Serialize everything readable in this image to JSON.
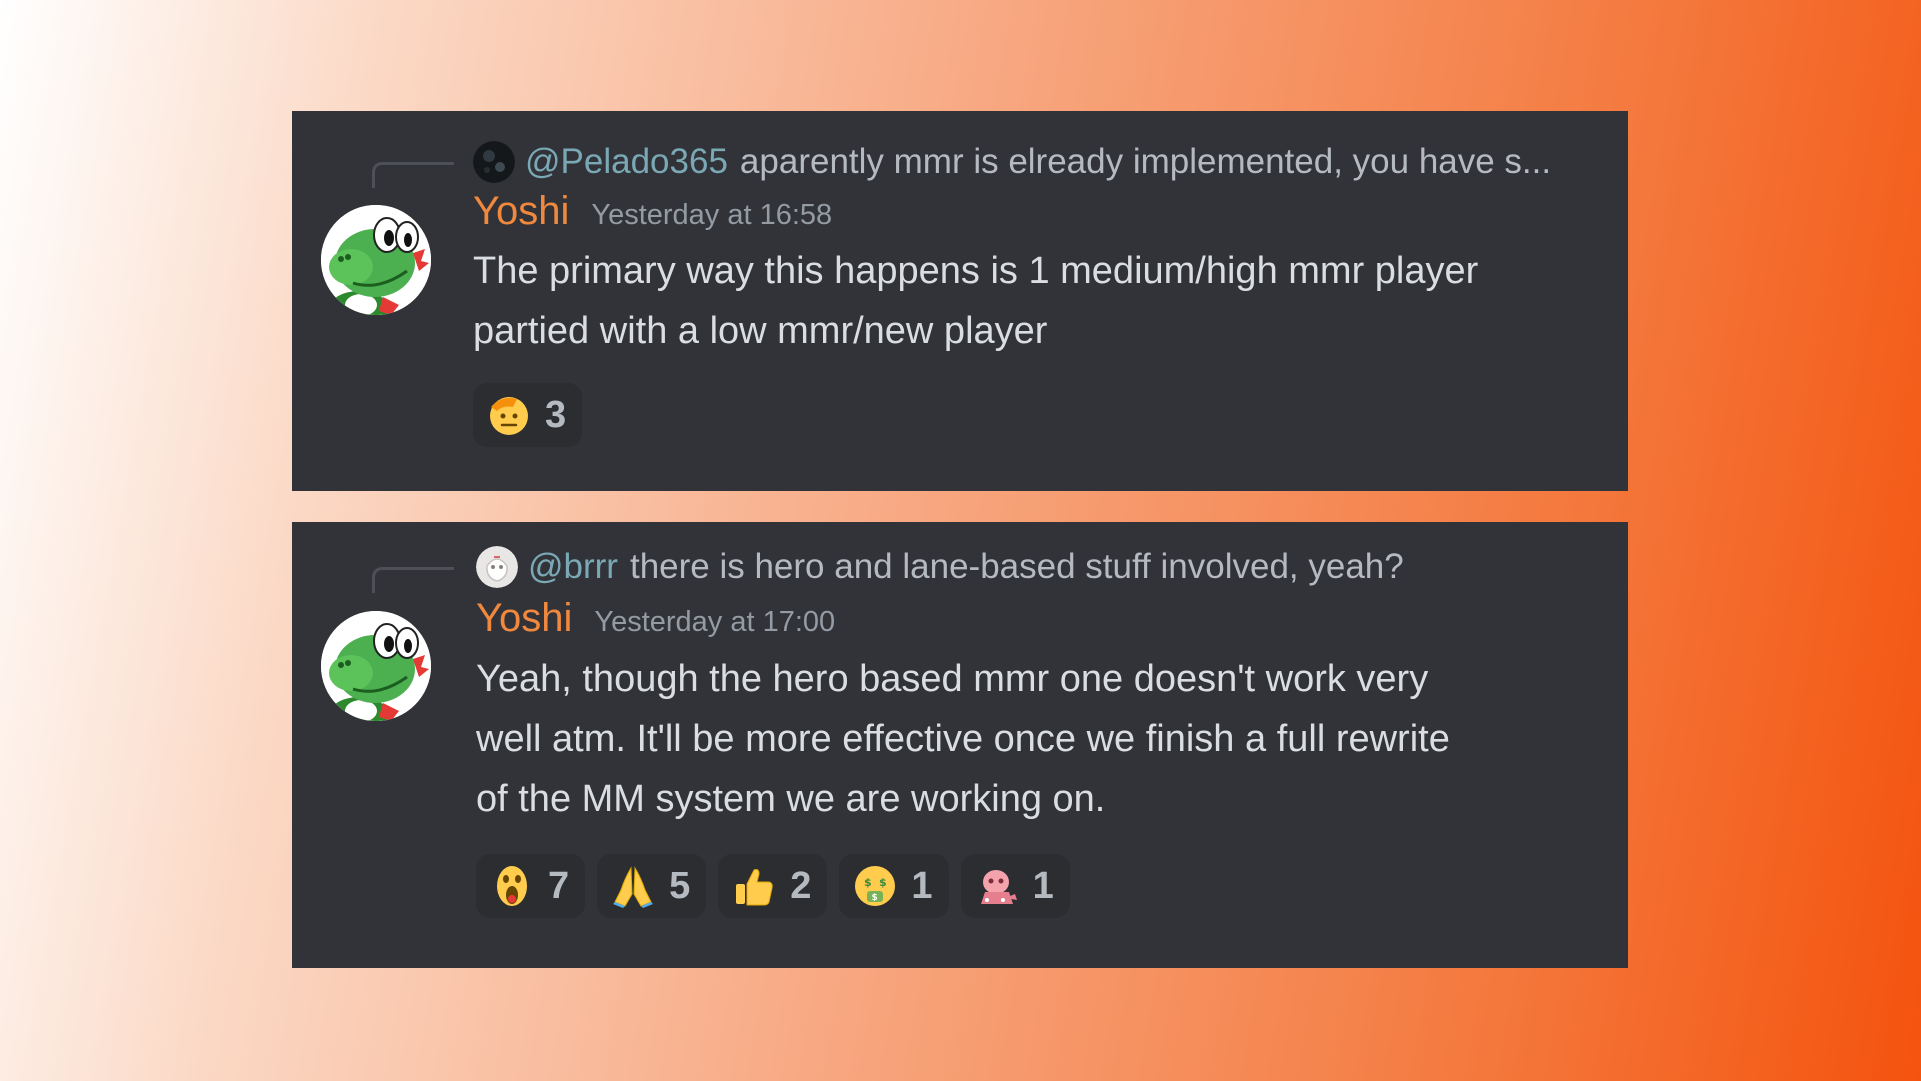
{
  "messages": [
    {
      "reply": {
        "mention": "@Pelado365",
        "text": "aparently mmr is elready implemented, you have s...",
        "avatar_icon": "dark-avatar-icon"
      },
      "author": "Yoshi",
      "timestamp": "Yesterday at 16:58",
      "avatar_icon": "yoshi-avatar-icon",
      "lines": [
        "The primary way this happens is 1 medium/high mmr player",
        "partied with a low mmr/new player"
      ],
      "reactions": [
        {
          "icon": "salute-face-emoji",
          "count": "3"
        }
      ]
    },
    {
      "reply": {
        "mention": "@brrr",
        "text": "there is hero and lane-based stuff involved, yeah?",
        "avatar_icon": "white-avatar-icon"
      },
      "author": "Yoshi",
      "timestamp": "Yesterday at 17:00",
      "avatar_icon": "yoshi-avatar-icon",
      "lines": [
        "Yeah, though the hero based mmr one doesn't work very",
        "well atm. It'll be more effective once we finish a full rewrite",
        "of the MM system we are working on."
      ],
      "reactions": [
        {
          "icon": "shocked-face-emoji",
          "count": "7"
        },
        {
          "icon": "folded-hands-emoji",
          "count": "5"
        },
        {
          "icon": "thumbs-up-emoji",
          "count": "2"
        },
        {
          "icon": "money-mouth-face-emoji",
          "count": "1"
        },
        {
          "icon": "pink-creature-emoji",
          "count": "1"
        }
      ]
    }
  ],
  "colors": {
    "card_background": "#313338",
    "username": "#f0883e",
    "mention": "#7aa8b5",
    "message_text": "#dbdee1",
    "timestamp": "#949ba4",
    "reaction_background": "#2b2d31"
  }
}
